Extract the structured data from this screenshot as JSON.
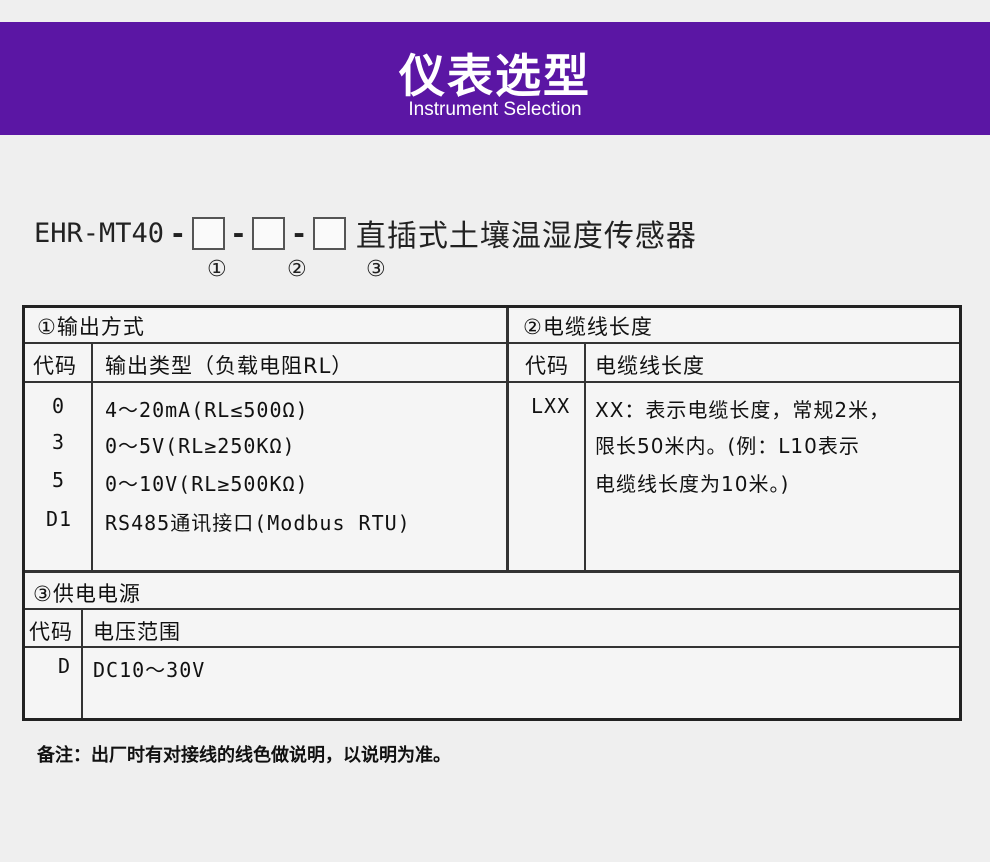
{
  "banner": {
    "title": "仪表选型",
    "subtitle": "Instrument Selection"
  },
  "model": {
    "code": "EHR-MT40",
    "separator": "-",
    "description": "直插式土壤温湿度传感器",
    "markers": [
      "①",
      "②",
      "③"
    ]
  },
  "output_section": {
    "title": "①输出方式",
    "col_code": "代码",
    "col_type": "输出类型（负载电阻RL）",
    "rows": [
      {
        "code": "0",
        "value": "4～20mA(RL≤500Ω)"
      },
      {
        "code": "3",
        "value": "0～5V(RL≥250KΩ)"
      },
      {
        "code": "5",
        "value": "0～10V(RL≥500KΩ)"
      },
      {
        "code": "D1",
        "value": "RS485通讯接口(Modbus RTU)"
      }
    ]
  },
  "cable_section": {
    "title": "②电缆线长度",
    "col_code": "代码",
    "col_length": "电缆线长度",
    "row_code": "LXX",
    "lines": [
      "XX：表示电缆长度，常规2米，",
      "限长50米内。(例：L10表示",
      "电缆线长度为10米。)"
    ]
  },
  "power_section": {
    "title": "③供电电源",
    "col_code": "代码",
    "col_range": "电压范围",
    "row_code": "D",
    "row_value": "DC10～30V"
  },
  "note": "备注：出厂时有对接线的线色做说明，以说明为准。"
}
